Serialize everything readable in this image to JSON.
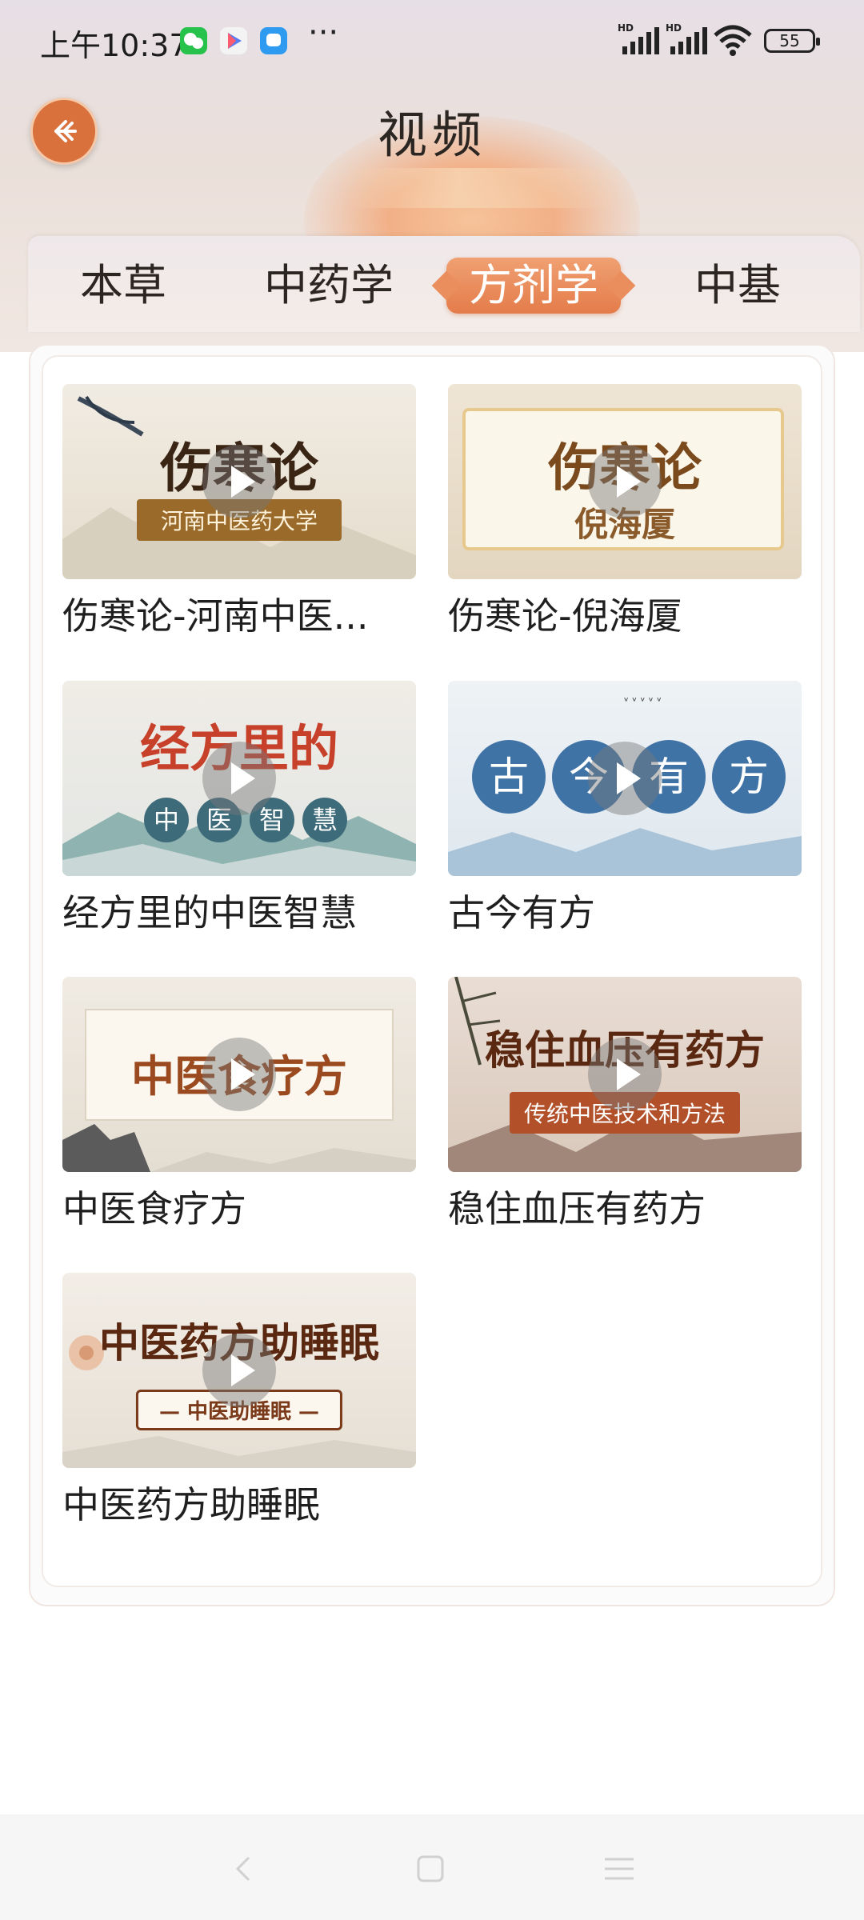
{
  "status_bar": {
    "time": "上午10:37",
    "more": "···",
    "hd1": "HD",
    "hd2": "HD",
    "battery": "55"
  },
  "header": {
    "title": "视频",
    "back_icon": "back-arrow-icon"
  },
  "tabs": [
    {
      "label": "本草",
      "active": false
    },
    {
      "label": "中药学",
      "active": false
    },
    {
      "label": "方剂学",
      "active": true
    },
    {
      "label": "中基",
      "active": false
    }
  ],
  "videos": [
    {
      "title": "伤寒论-河南中医...",
      "thumb_main": "伤寒论",
      "thumb_sub": "河南中医药大学"
    },
    {
      "title": "伤寒论-倪海厦",
      "thumb_main": "伤寒论",
      "thumb_sub": "倪海厦"
    },
    {
      "title": "经方里的中医智慧",
      "thumb_main": "经方里的",
      "thumb_sub_chars": [
        "中",
        "医",
        "智",
        "慧"
      ]
    },
    {
      "title": "古今有方",
      "thumb_chars": [
        "古",
        "今",
        "有",
        "方"
      ]
    },
    {
      "title": "中医食疗方",
      "thumb_main": "中医食疗方"
    },
    {
      "title": "稳住血压有药方",
      "thumb_main": "稳住血压有药方",
      "thumb_sub": "传统中医技术和方法"
    },
    {
      "title": "中医药方助睡眠",
      "thumb_main": "中医药方助睡眠",
      "thumb_sub": "— 中医助睡眠 —"
    }
  ],
  "colors": {
    "accent": "#e47c4a",
    "back_button": "#d8713c",
    "thumb_title_red": "#c6402a",
    "thumb_title_brown": "#6a3418",
    "circle_blue": "#3f73a6"
  },
  "nav": {
    "back": "nav-back-icon",
    "home": "nav-home-icon",
    "menu": "nav-menu-icon"
  }
}
